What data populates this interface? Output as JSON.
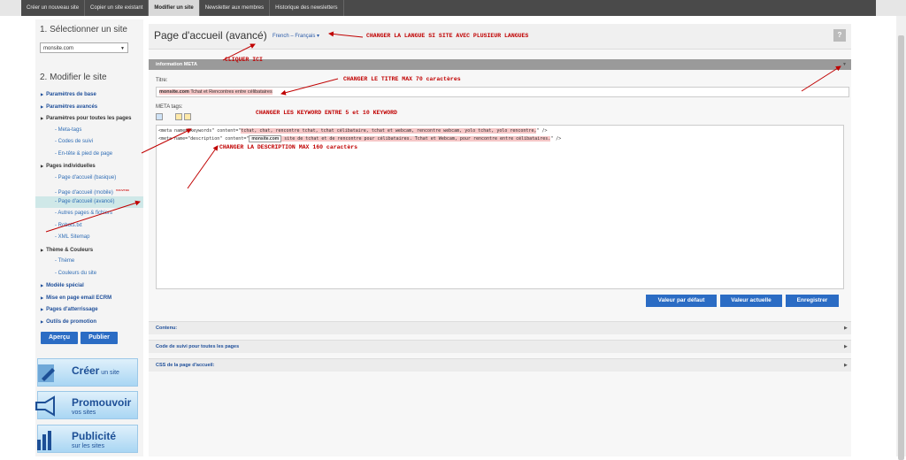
{
  "topnav": {
    "tabs": [
      {
        "label": "Créer un nouveau site"
      },
      {
        "label": "Copier un site existant"
      },
      {
        "label": "Modifier un site",
        "active": true
      },
      {
        "label": "Newsletter aux membres"
      },
      {
        "label": "Historique des newsletters"
      }
    ]
  },
  "sidebar": {
    "section1_title": "1. Sélectionner un site",
    "site_select_value": "monsite.com",
    "section2_title": "2. Modifier le site",
    "items": [
      {
        "label": "Paramètres de base",
        "type": "bold"
      },
      {
        "label": "Paramètres avancés",
        "type": "bold"
      },
      {
        "label": "Paramètres pour toutes les pages",
        "type": "head"
      },
      {
        "label": "Meta-tags",
        "type": "sub"
      },
      {
        "label": "Codes de suivi",
        "type": "sub"
      },
      {
        "label": "En-tête & pied de page",
        "type": "sub"
      },
      {
        "label": "Pages individuelles",
        "type": "head"
      },
      {
        "label": "Page d'accueil (basique)",
        "type": "sub"
      },
      {
        "label": "Page d'accueil (mobile)",
        "type": "sub",
        "badge": "nouveau"
      },
      {
        "label": "Page d'accueil (avancé)",
        "type": "sub",
        "active": true
      },
      {
        "label": "Autres pages & fichiers",
        "type": "sub"
      },
      {
        "label": "Robots.txt",
        "type": "sub"
      },
      {
        "label": "XML Sitemap",
        "type": "sub"
      },
      {
        "label": "Thème & Couleurs",
        "type": "head"
      },
      {
        "label": "Thème",
        "type": "sub"
      },
      {
        "label": "Couleurs du site",
        "type": "sub"
      },
      {
        "label": "Modèle spécial",
        "type": "bold"
      },
      {
        "label": "Mise en page email ECRM",
        "type": "bold"
      },
      {
        "label": "Pages d'atterrissage",
        "type": "bold"
      },
      {
        "label": "Outils de promotion",
        "type": "bold"
      }
    ],
    "preview_button": "Aperçu",
    "publish_button": "Publier",
    "promos": [
      {
        "big": "Créer",
        "small": " un site",
        "sub": "",
        "icon": "pencil-icon"
      },
      {
        "big": "Promouvoir",
        "small": "",
        "sub": "vos sites",
        "icon": "megaphone-icon"
      },
      {
        "big": "Publicité",
        "small": "",
        "sub": "sur les sites",
        "icon": "bar-chart-icon"
      }
    ]
  },
  "main": {
    "page_title": "Page d'accueil (avancé)",
    "language": "French – Français",
    "help": "?",
    "meta_section": "information META",
    "title_label": "Titre:",
    "title_site": "monsite.com",
    "title_value": " Tchat et Rencontres entre célibataires",
    "meta_label": "META tags:",
    "meta_line1_pre": "<meta name=\"keywords\" content=\"",
    "meta_line1_hl": "tchat, chat, rencontre tchat, tchat célibataire, tchat et webcam, rencontre webcam, yolo tchat, yolo rencontre,",
    "meta_line1_post": "\" />",
    "meta_line2_pre": "<meta name=\"description\" content=\"",
    "meta_line2_site": "monsite.com",
    "meta_line2_hl": "  site de tchat et de rencontre pour célibataires. Tchat et Webcam, pour rencontre entre célibataires.",
    "meta_line2_post": "\" />",
    "btn_default": "Valeur par défaut",
    "btn_current": "Valeur actuelle",
    "btn_save": "Enregistrer",
    "accordions": [
      {
        "label": "Contenu:"
      },
      {
        "label": "Code de suivi pour toutes les pages"
      },
      {
        "label": "CSS de la page d'accueil:"
      }
    ]
  },
  "annotations": {
    "lang": "CHANGER LA LANGUE SI SITE AVEC PLUSIEUR LANGUES",
    "click": "CLIQUER ICI",
    "title": "CHANGER LE TITRE MAX 70 caractères",
    "keywords": "CHANGER LES KEYWORD ENTRE 5 et 10 KEYWORD",
    "description": "CHANGER LA DESCRIPTION MAX 160 caractèrs"
  },
  "colors": {
    "accent": "#2b6cc4",
    "annotation": "#c00000",
    "highlight": "#f6c7c7"
  }
}
